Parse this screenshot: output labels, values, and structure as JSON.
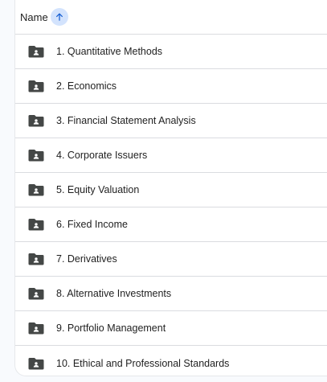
{
  "header": {
    "column_label": "Name",
    "sort_icon": "arrow-up-icon",
    "accent_color": "#0b57d0"
  },
  "rows": [
    {
      "label": "1. Quantitative Methods",
      "icon": "shared-folder-icon"
    },
    {
      "label": "2. Economics",
      "icon": "shared-folder-icon"
    },
    {
      "label": "3. Financial Statement Analysis",
      "icon": "shared-folder-icon"
    },
    {
      "label": "4. Corporate Issuers",
      "icon": "shared-folder-icon"
    },
    {
      "label": "5. Equity Valuation",
      "icon": "shared-folder-icon"
    },
    {
      "label": "6. Fixed Income",
      "icon": "shared-folder-icon"
    },
    {
      "label": "7. Derivatives",
      "icon": "shared-folder-icon"
    },
    {
      "label": "8. Alternative Investments",
      "icon": "shared-folder-icon"
    },
    {
      "label": "9. Portfolio Management",
      "icon": "shared-folder-icon"
    },
    {
      "label": "10. Ethical and Professional Standards",
      "icon": "shared-folder-icon"
    }
  ]
}
